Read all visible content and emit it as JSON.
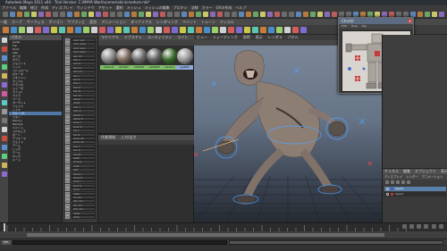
{
  "window": {
    "title": "Autodesk Maya 2011 x64 - Trial Version: C:\\MAYA Work\\scenes\\skin\\creature.mb*"
  },
  "menubar": {
    "items": [
      "ファイル",
      "編集",
      "修正",
      "作成",
      "ディスプレイ",
      "ウィンドウ",
      "アセット",
      "選択",
      "メッシュ",
      "メッシュの編集",
      "プロキシ",
      "法線",
      "カラー",
      "UVの作成",
      "ヘルプ"
    ]
  },
  "shelf_tabs": {
    "items": [
      "一般",
      "カーブ",
      "サーフェス",
      "ポリゴン",
      "サブディビ",
      "変形",
      "アニメーション",
      "ダイナミクス",
      "レンダリング",
      "ペイント",
      "トゥーン",
      "マッスル"
    ]
  },
  "outliner": {
    "title": "パネル",
    "rows": [
      "persp",
      "top",
      "front",
      "side",
      "ポーズ",
      "ボディ",
      "ジョイント",
      "ヘッド",
      "コントロール",
      "ロケータ",
      "ジオメトリ",
      "マッスル",
      "クラスタ",
      "シェーダ",
      "ライト1",
      "カメラ",
      "ベース",
      "ターゲット",
      "フェイス",
      "レイヤ",
      "グループ1",
      "スキン",
      "Hand_L",
      "Hand_R",
      "ペイント",
      "スペキュラ",
      "ボーン",
      "デフォーマ",
      "ウェイト",
      "アーム",
      "レッグ",
      "テール",
      "ネック",
      "ルート"
    ],
    "selected_index": 20
  },
  "hypergraph": {
    "nodes": [
      "joint_root",
      "joint_spine",
      "joint_neck",
      "joint_head",
      "jaw_ctrl",
      "arm_L",
      "arm_R",
      "hand_L",
      "hand_R",
      "leg_L",
      "leg_R",
      "foot_L",
      "foot_R",
      "tail_01",
      "tail_02",
      "pelvis",
      "chest",
      "clav_L",
      "clav_R",
      "elbow_L",
      "elbow_R",
      "knee_L",
      "knee_R",
      "toe_L",
      "toe_R",
      "spine_02",
      "spine_03",
      "eye_L",
      "eye_R",
      "mouth",
      "teeth",
      "tongue",
      "cloth",
      "belt",
      "glove_L",
      "glove_R",
      "boot_L",
      "boot_R",
      "hood",
      "mask",
      "rig_grp",
      "geo_grp",
      "ctrl_grp",
      "skin_grp",
      "lights",
      "cams"
    ]
  },
  "hypershade": {
    "tabs": [
      "マテリアル",
      "テクスチャ",
      "ユーティリティ",
      "ライト",
      "カメラ"
    ],
    "materials": [
      {
        "label": "lambert1",
        "color": "#8a8a8a"
      },
      {
        "label": "skinMAT",
        "color": "#7d6a5e"
      },
      {
        "label": "clothMAT",
        "color": "#6d6d6d"
      },
      {
        "label": "metalMAT",
        "color": "#5f5f5f"
      },
      {
        "label": "checker1",
        "color": "#3a6b2c"
      },
      {
        "label": "eyeMAT",
        "color": "#9a9a9a"
      }
    ],
    "bottom_tabs": [
      "作業領域",
      "入力/出力"
    ]
  },
  "viewport": {
    "menu": [
      "ビュー",
      "シェーディング",
      "照明",
      "表示",
      "レンダラ",
      "パネル"
    ]
  },
  "character_ui": {
    "title": "CharUI",
    "close_label": "×",
    "menu": [
      "Edit",
      "Pose",
      "Rig"
    ]
  },
  "channel_box": {
    "header": [
      "チャネル",
      "編集",
      "オブジェクト",
      "表示"
    ],
    "layer_tabs": [
      "ディスプレイ",
      "レンダー",
      "アニメーション"
    ],
    "layers": [
      {
        "name": "layer2",
        "color": "#3a5fb0",
        "v": "V"
      },
      {
        "name": "layer1",
        "color": "#b03a3a",
        "v": "V"
      }
    ]
  },
  "timeline": {
    "start": "1",
    "end": "24",
    "current": "1"
  },
  "range": {
    "start": "1.00",
    "end": "24.00",
    "min": "1.00",
    "max": "48.00"
  },
  "command_line": {
    "mode": "MEL"
  }
}
